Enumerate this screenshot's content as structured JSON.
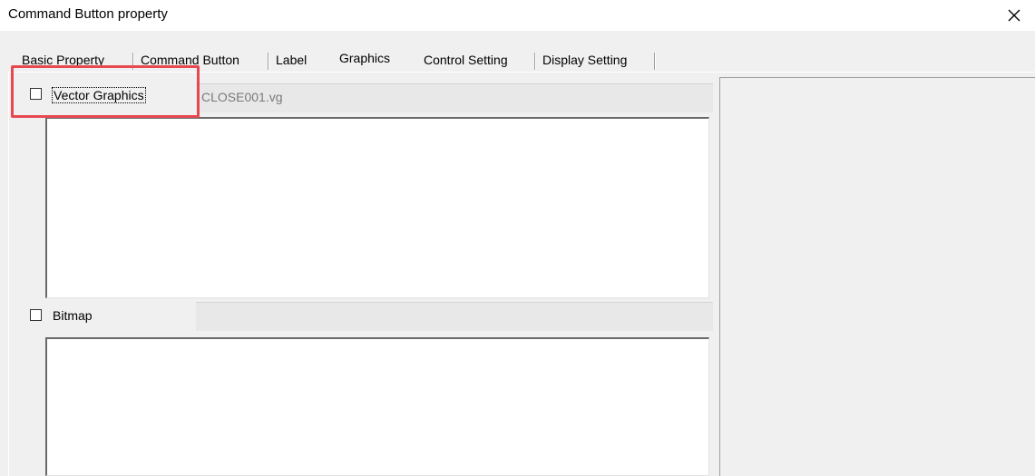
{
  "window": {
    "title": "Command Button property",
    "close_icon": "close-icon"
  },
  "tabs": [
    {
      "label": "Basic Property",
      "active": false
    },
    {
      "label": "Command Button",
      "active": false
    },
    {
      "label": "Label",
      "active": false
    },
    {
      "label": "Graphics",
      "active": true
    },
    {
      "label": "Control Setting",
      "active": false
    },
    {
      "label": "Display Setting",
      "active": false
    }
  ],
  "graphics": {
    "vector": {
      "checkbox_label": "Vector Graphics",
      "checked": false,
      "file_name": "CLOSE001.vg"
    },
    "bitmap": {
      "checkbox_label": "Bitmap",
      "checked": false,
      "file_name": ""
    }
  },
  "annotation": {
    "highlight_color": "#e8484f"
  }
}
